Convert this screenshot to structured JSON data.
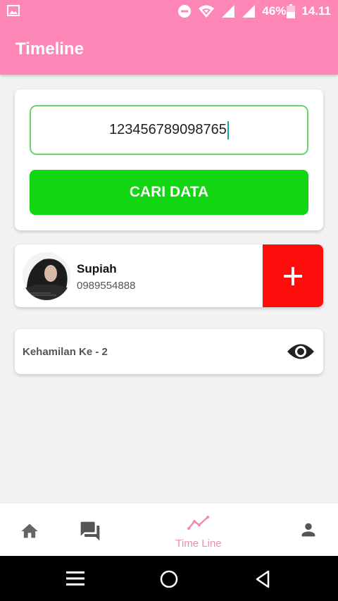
{
  "status_bar": {
    "image_icon": "image-icon",
    "icons": [
      "do-not-disturb-icon",
      "wifi-icon",
      "signal-icon",
      "signal-icon",
      "battery-icon"
    ],
    "battery": "46%",
    "time": "14.11"
  },
  "app_bar": {
    "title": "Timeline"
  },
  "search": {
    "value": "12345678909876​5",
    "button_label": "CARI DATA"
  },
  "patient": {
    "name": "Supiah",
    "phone": "0989554888",
    "add_icon": "plus-icon"
  },
  "pregnancy": {
    "label": "Kehamilan Ke - 2",
    "view_icon": "eye-icon"
  },
  "bottom_nav": {
    "items": [
      {
        "icon": "home-icon"
      },
      {
        "icon": "chat-icon"
      },
      {
        "icon": "timeline-icon",
        "label": "Time Line",
        "active": true
      },
      {
        "icon": "person-icon"
      }
    ],
    "active_color": "#f08ab2",
    "inactive_color": "#666666"
  },
  "system_nav": {
    "icons": [
      "menu-icon",
      "home-circle-icon",
      "back-icon"
    ]
  },
  "colors": {
    "primary": "#ff87b7",
    "search_button": "#11d611",
    "add_button": "#ff0c0c",
    "input_border": "#6cd36a"
  }
}
